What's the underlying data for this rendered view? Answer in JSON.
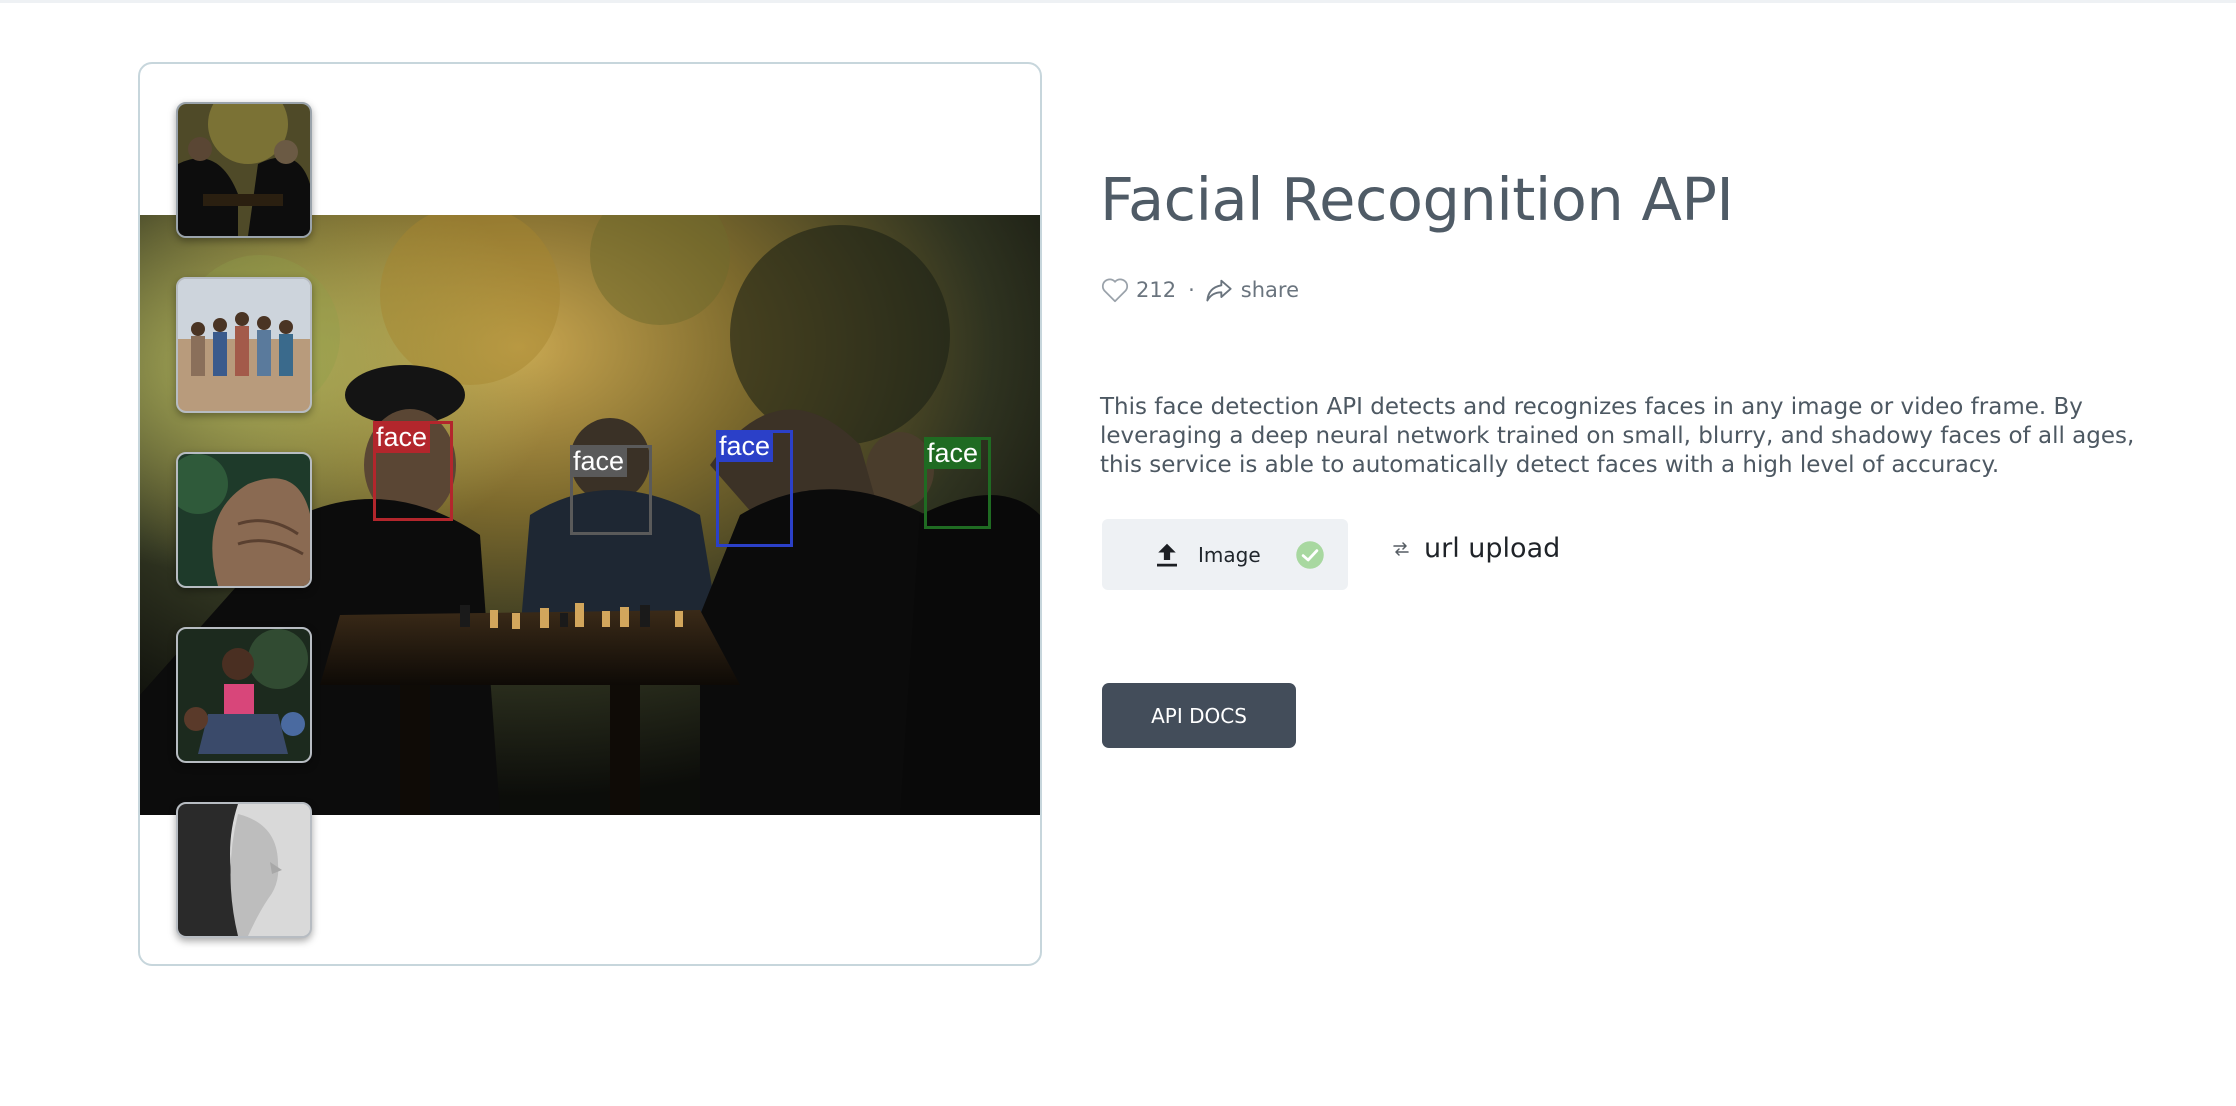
{
  "demo": {
    "detections": [
      {
        "label": "face",
        "color": "#b3262c"
      },
      {
        "label": "face",
        "color": "#5a5a5a"
      },
      {
        "label": "face",
        "color": "#2b40c8"
      },
      {
        "label": "face",
        "color": "#1f6b22"
      }
    ],
    "thumbnails": [
      {
        "name": "chess-players",
        "active": true
      },
      {
        "name": "children-group",
        "active": false
      },
      {
        "name": "elder-face",
        "active": false
      },
      {
        "name": "smiling-woman",
        "active": false
      },
      {
        "name": "woman-profile-bw",
        "active": false
      }
    ]
  },
  "info": {
    "title": "Facial Recognition API",
    "likes": "212",
    "separator": "·",
    "share_label": "share",
    "description": "This face detection API detects and recognizes faces in any image or video frame. By leveraging a deep neural network trained on small, blurry, and shadowy faces of all ages, this service is able to automatically detect faces with a high level of accuracy.",
    "image_button": "Image",
    "url_upload": "url upload",
    "docs_button": "API DOCS"
  },
  "icons": {
    "like": "heart-icon",
    "share": "share-icon",
    "upload": "upload-icon",
    "check": "check-circle-icon",
    "swap": "swap-icon"
  },
  "colors": {
    "docs_button_bg": "#434d5a",
    "image_button_bg": "#eef1f4",
    "check": "#a8d8a0",
    "title": "#4f5b66",
    "frame_border": "#c7d6dc"
  }
}
